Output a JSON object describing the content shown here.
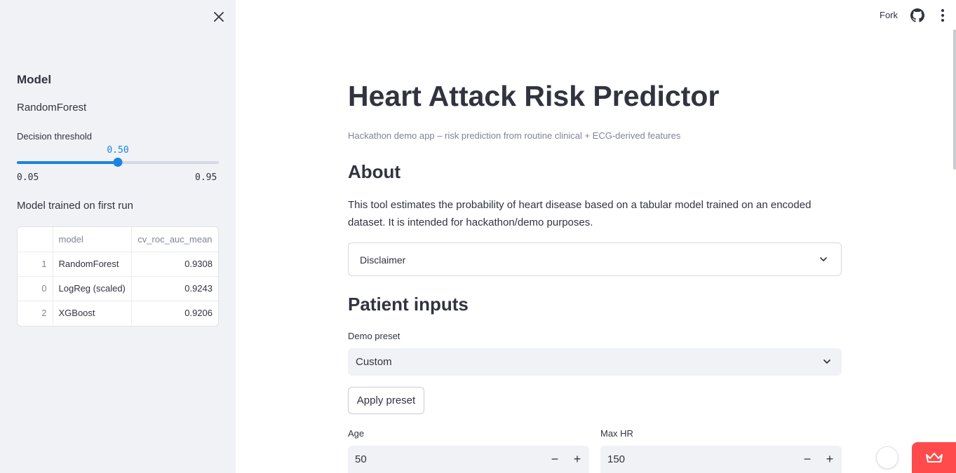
{
  "sidebar": {
    "section_title": "Model",
    "model_name": "RandomForest",
    "threshold": {
      "label": "Decision threshold",
      "value": 0.5,
      "value_text": "0.50",
      "min": 0.05,
      "max": 0.95,
      "min_text": "0.05",
      "max_text": "0.95"
    },
    "trained_note": "Model trained on first run",
    "table": {
      "columns": [
        "",
        "model",
        "cv_roc_auc_mean"
      ],
      "rows": [
        {
          "index": "1",
          "model": "RandomForest",
          "score": "0.9308"
        },
        {
          "index": "0",
          "model": "LogReg (scaled)",
          "score": "0.9243"
        },
        {
          "index": "2",
          "model": "XGBoost",
          "score": "0.9206"
        }
      ]
    }
  },
  "header": {
    "fork_label": "Fork",
    "icons": [
      "github-icon",
      "more-vertical-icon"
    ]
  },
  "main": {
    "title": "Heart Attack Risk Predictor",
    "caption": "Hackathon demo app – risk prediction from routine clinical + ECG-derived features",
    "about_heading": "About",
    "about_text": "This tool estimates the probability of heart disease based on a tabular model trained on an encoded dataset. It is intended for hackathon/demo purposes.",
    "disclaimer_label": "Disclaimer",
    "patient_heading": "Patient inputs",
    "preset": {
      "label": "Demo preset",
      "value": "Custom"
    },
    "apply_label": "Apply preset",
    "age": {
      "label": "Age",
      "value": "50"
    },
    "max_hr": {
      "label": "Max HR",
      "value": "150"
    }
  },
  "colors": {
    "accent": "#1c83e1",
    "sidebar_bg": "#f0f2f6",
    "text": "#31333f",
    "muted": "#808495",
    "badge": "#ff4b4b"
  }
}
